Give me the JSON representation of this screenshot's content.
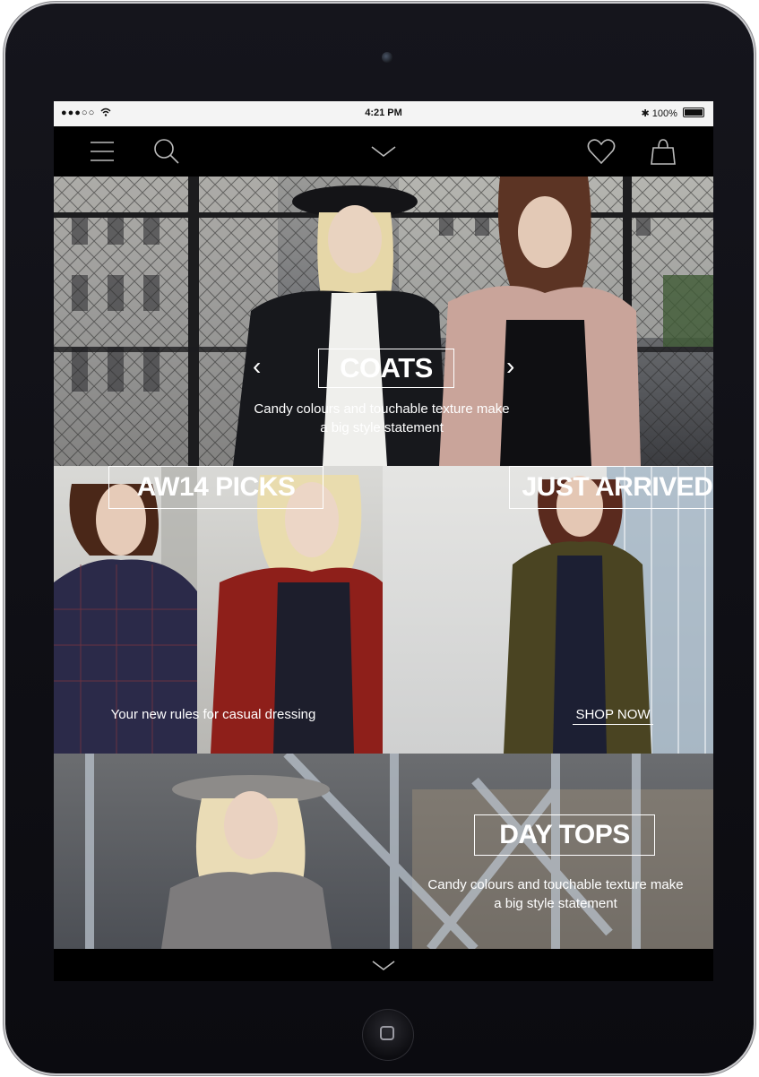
{
  "status_bar": {
    "signal": "●●●○○",
    "time": "4:21 PM",
    "battery": "100%"
  },
  "nav": {
    "menu_icon": "hamburger-icon",
    "search_icon": "search-icon",
    "dropdown_icon": "chevron-down-icon",
    "wishlist_icon": "heart-icon",
    "bag_icon": "shopping-bag-icon"
  },
  "hero": {
    "title": "COATS",
    "subtitle_line1": "Candy colours and touchable texture make",
    "subtitle_line2": "a big style statement",
    "prev": "‹",
    "next": "›"
  },
  "tiles": {
    "aw14": {
      "title": "AW14 PICKS",
      "subtitle": "Your new rules for casual dressing"
    },
    "just_arrived": {
      "title": "JUST ARRIVED",
      "cta": "SHOP NOW"
    }
  },
  "day_tops": {
    "title": "DAY TOPS",
    "subtitle_line1": "Candy colours and touchable texture make",
    "subtitle_line2": "a big style statement"
  },
  "bottom": {
    "scroll_icon": "chevron-down-icon"
  },
  "colors": {
    "background": "#000000",
    "text": "#ffffff",
    "status_bar": "#f4f4f4"
  }
}
